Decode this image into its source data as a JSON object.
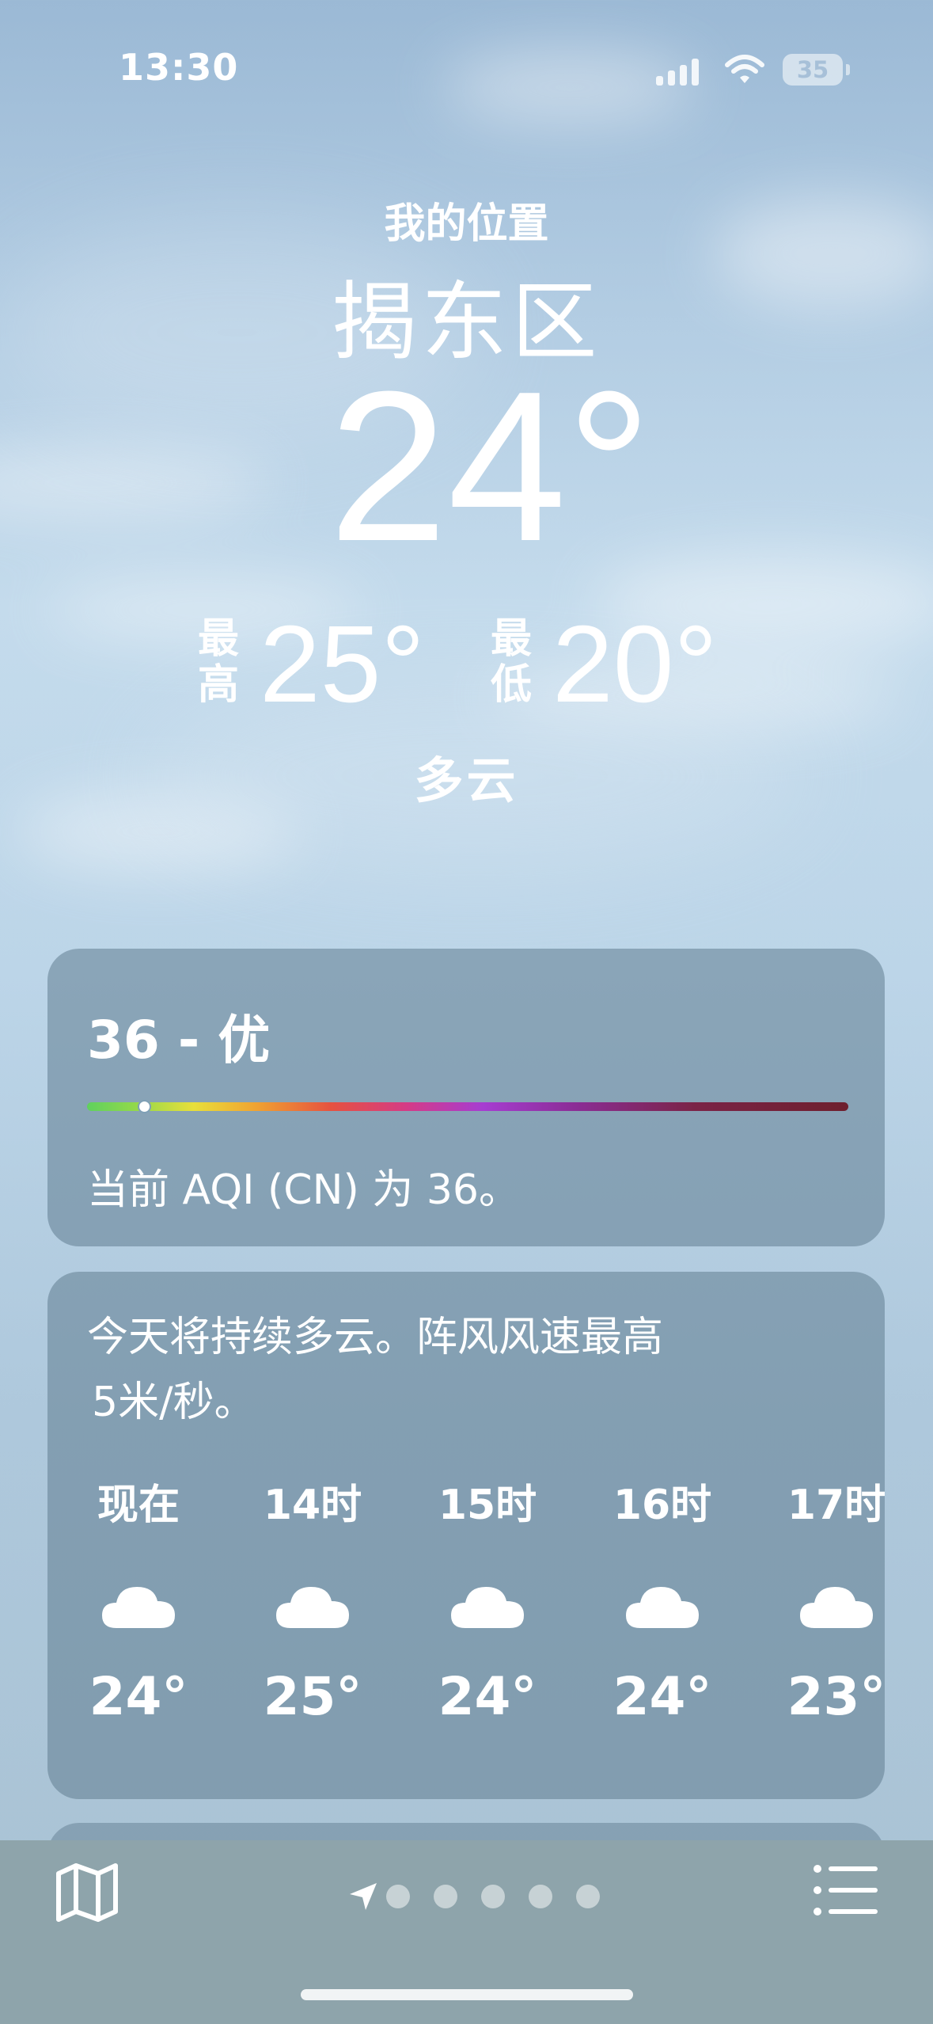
{
  "status_bar": {
    "time": "13:30",
    "battery_level": "35",
    "icons": [
      "cellular-signal-icon",
      "wifi-icon",
      "battery-icon"
    ]
  },
  "header": {
    "location_label": "我的位置",
    "city": "揭东区",
    "current_temp": "24°",
    "high_label": "最高",
    "high_temp": "25°",
    "low_label": "最低",
    "low_temp": "20°",
    "condition": "多云"
  },
  "aqi": {
    "value_text": "36 - 优",
    "description": "当前 AQI (CN) 为 36。",
    "level_fraction": 0.075,
    "gradient_colors": [
      "#5fd15e",
      "#e8df3a",
      "#f0a431",
      "#e6523f",
      "#d43b86",
      "#a63dd1",
      "#6e1f2e"
    ]
  },
  "hourly": {
    "summary": "今天将持续多云。阵风风速最高\n5米/秒。",
    "hours": [
      {
        "time": "现在",
        "icon": "cloud-icon",
        "temp": "24°"
      },
      {
        "time": "14时",
        "icon": "cloud-icon",
        "temp": "25°"
      },
      {
        "time": "15时",
        "icon": "cloud-icon",
        "temp": "24°"
      },
      {
        "time": "16时",
        "icon": "cloud-icon",
        "temp": "24°"
      },
      {
        "time": "17时",
        "icon": "cloud-icon",
        "temp": "23°"
      }
    ]
  },
  "bottom_bar": {
    "icons": [
      "map-icon",
      "location-arrow-icon",
      "list-icon"
    ],
    "page_count": 5
  }
}
